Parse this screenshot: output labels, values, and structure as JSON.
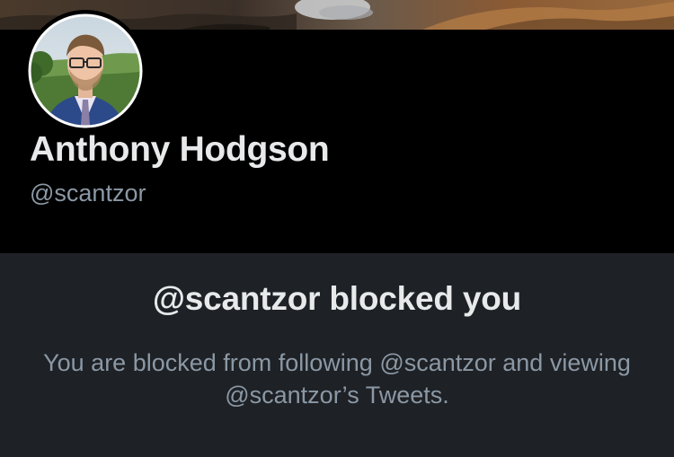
{
  "profile": {
    "display_name": "Anthony Hodgson",
    "handle": "@scantzor"
  },
  "blocked_notice": {
    "title": "@scantzor blocked you",
    "message": "You are blocked from following @scantzor and viewing @scantzor’s Tweets."
  },
  "colors": {
    "background": "#000000",
    "panel_background": "#1e2125",
    "primary_text": "#e7e9ea",
    "secondary_text": "#8b98a5"
  }
}
